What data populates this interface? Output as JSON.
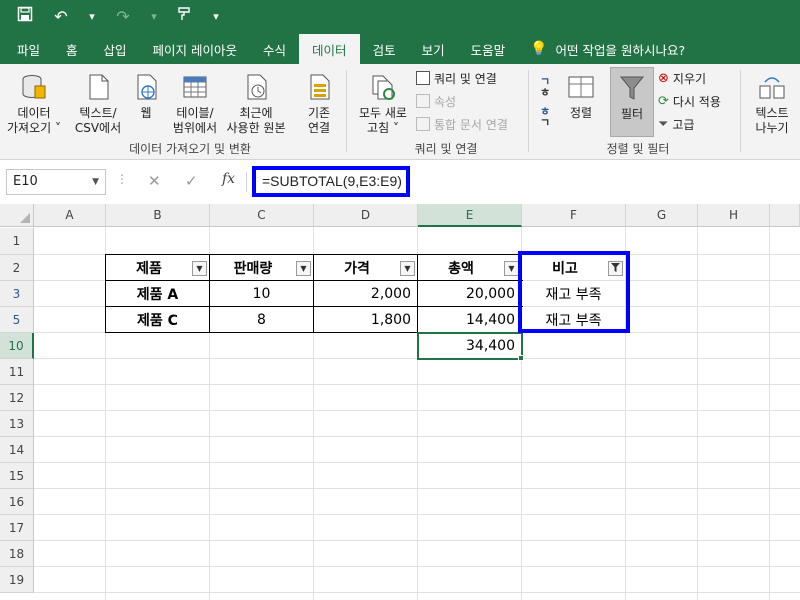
{
  "quick_access": {
    "save_icon": "save-icon",
    "undo_icon": "undo-icon",
    "redo_icon": "redo-icon",
    "format_icon": "format-painter-icon",
    "more_icon": "customize-icon"
  },
  "tabs": [
    "파일",
    "홈",
    "삽입",
    "페이지 레이아웃",
    "수식",
    "데이터",
    "검토",
    "보기",
    "도움말"
  ],
  "active_tab": "데이터",
  "tell_me": "어떤 작업을 원하시나요?",
  "ribbon": {
    "get_data": [
      "데이터",
      "가져오기 ˅"
    ],
    "text_csv": [
      "텍스트/",
      "CSV에서"
    ],
    "web": "웹",
    "table_range": [
      "테이블/",
      "범위에서"
    ],
    "recent_sources": [
      "최근에",
      "사용한 원본"
    ],
    "existing_conn": [
      "기존",
      "연결"
    ],
    "group_get_transform": "데이터 가져오기 및 변환",
    "refresh_all": [
      "모두 새로",
      "고침 ˅"
    ],
    "queries_connections": "쿼리 및 연결",
    "properties": "속성",
    "edit_links": "통합 문서 연결",
    "group_queries": "쿼리 및 연결",
    "sort_az": [
      "ㄱ",
      "ㅎ"
    ],
    "sort_za": [
      "ㅎ",
      "ㄱ"
    ],
    "sort": "정렬",
    "filter": "필터",
    "clear": "지우기",
    "reapply": "다시 적용",
    "advanced": "고급",
    "group_sort_filter": "정렬 및 필터",
    "text_to_columns": [
      "텍스트",
      "나누기"
    ]
  },
  "formula_bar": {
    "name_box": "E10",
    "formula": "=SUBTOTAL(9,E3:E9)",
    "fx": "fx"
  },
  "columns": [
    "A",
    "B",
    "C",
    "D",
    "E",
    "F",
    "G",
    "H"
  ],
  "selected_column": "E",
  "rows": [
    "1",
    "2",
    "3",
    "5",
    "10",
    "11",
    "12",
    "13",
    "14",
    "15",
    "16",
    "17",
    "18",
    "19"
  ],
  "selected_row": "10",
  "table": {
    "headers": [
      "제품",
      "판매량",
      "가격",
      "총액",
      "비고"
    ],
    "rows": [
      [
        "제품 A",
        "10",
        "2,000",
        "20,000",
        "재고 부족"
      ],
      [
        "제품 C",
        "8",
        "1,800",
        "14,400",
        "재고 부족"
      ]
    ],
    "total": "34,400"
  },
  "colors": {
    "accent": "#217346",
    "highlight": "#0000ff"
  }
}
